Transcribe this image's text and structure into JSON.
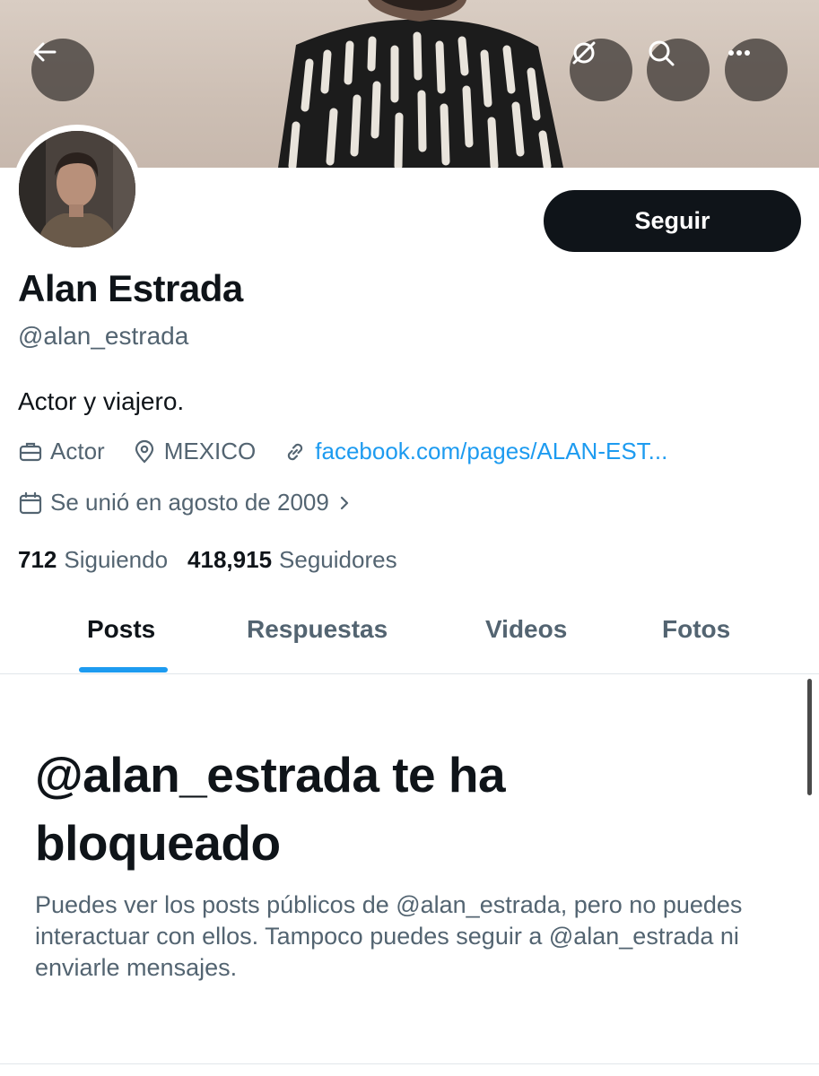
{
  "header": {
    "back_icon": "arrow-left-icon",
    "grok_icon": "grok-icon",
    "search_icon": "search-icon",
    "more_icon": "more-icon"
  },
  "profile": {
    "name": "Alan Estrada",
    "handle": "@alan_estrada",
    "bio": "Actor y viajero.",
    "category": "Actor",
    "location": "MEXICO",
    "website": "facebook.com/pages/ALAN-EST...",
    "joined": "Se unió en agosto de 2009",
    "following_count": "712",
    "following_label": "Siguiendo",
    "followers_count": "418,915",
    "followers_label": "Seguidores",
    "follow_label": "Seguir"
  },
  "tabs": [
    {
      "label": "Posts",
      "active": true
    },
    {
      "label": "Respuestas",
      "active": false
    },
    {
      "label": "Videos",
      "active": false
    },
    {
      "label": "Fotos",
      "active": false
    }
  ],
  "blocked": {
    "title": "@alan_estrada te ha bloqueado",
    "description": "Puedes ver los posts públicos de @alan_estrada, pero no puedes interactuar con ellos. Tampoco puedes seguir a @alan_estrada ni enviarle mensajes."
  },
  "colors": {
    "accent": "#1d9bf0",
    "text": "#0f1419",
    "secondary": "#536471"
  }
}
